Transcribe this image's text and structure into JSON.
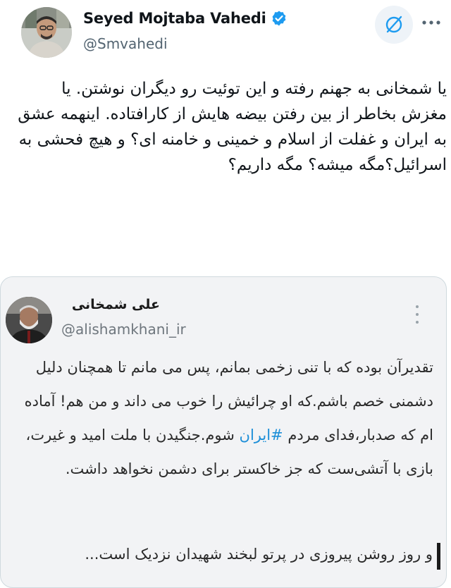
{
  "author": {
    "name": "Seyed Mojtaba Vahedi",
    "handle": "@Smvahedi",
    "verified_color": "#1d9bf0",
    "avatar_icon": "profile-photo"
  },
  "actions": {
    "grok_icon": "grok-icon",
    "more_icon": "more-horizontal-icon"
  },
  "tweet": {
    "text": "یا شمخانی به جهنم رفته و این توئیت رو دیگران نوشتن. یا مغزش بخاطر از بین رفتن بیضه هایش از کارافتاده. اینهمه عشق به ایران و غفلت از اسلام و خمینی و خامنه ای؟ و هیچ فحشی به اسرائیل؟مگه میشه؟ مگه داریم؟"
  },
  "quoted": {
    "name": "علی شمخانی",
    "handle": "@alishamkhani_ir",
    "text_part1": "تقدیرآن بوده که با تنی زخمی بمانم، پس می مانم تا همچنان دلیل دشمنی خصم باشم.که او چرائیش را خوب می داند و من هم! آماده ام که صدبار،فدای مردم ",
    "hashtag": "#ایران",
    "text_part2": " شوم.جنگیدن با ملت امید و غیرت، بازی با آتشی‌ست که جز خاکستر برای دشمن نخواهد داشت.",
    "last_line": "و روز روشن پیروزی در پرتو لبخند شهیدان نزدیک است..."
  },
  "colors": {
    "hashtag": "#1d8fd8",
    "handle": "#536471",
    "card_border": "#cfd9de"
  }
}
